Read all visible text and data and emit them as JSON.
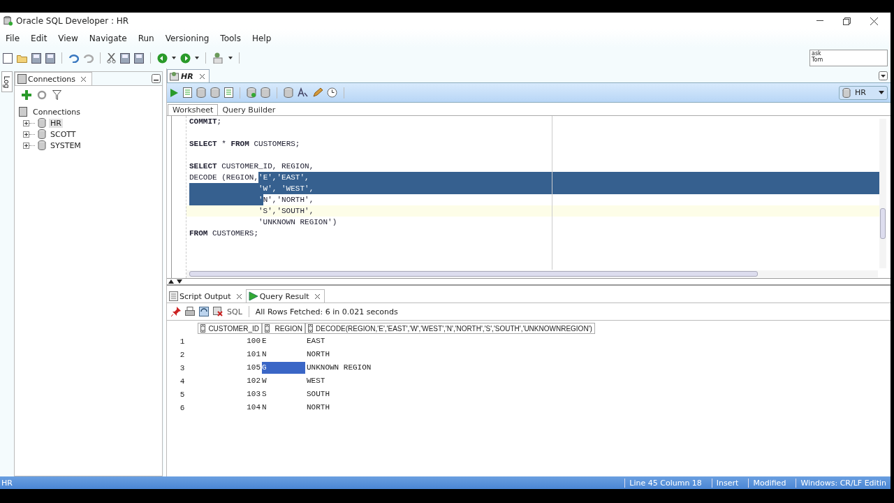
{
  "window": {
    "title": "Oracle SQL Developer : HR"
  },
  "menu": [
    "File",
    "Edit",
    "View",
    "Navigate",
    "Run",
    "Versioning",
    "Tools",
    "Help"
  ],
  "search_box": {
    "lines": [
      "ask",
      "Tom"
    ]
  },
  "left_panel": {
    "side_tab": "Log",
    "tab": "Connections",
    "tree": {
      "label": "Connections",
      "children": [
        {
          "label": "HR",
          "selected": true,
          "expanded": false
        },
        {
          "label": "SCOTT",
          "selected": false,
          "expanded": false
        },
        {
          "label": "SYSTEM",
          "selected": false,
          "expanded": false
        }
      ]
    }
  },
  "editor": {
    "tab": "HR",
    "connection": "HR",
    "subtabs": [
      {
        "label": "Worksheet",
        "selected": true
      },
      {
        "label": "Query Builder",
        "selected": false
      }
    ],
    "lines": [
      {
        "current": false,
        "parts": [
          {
            "text": "**COMMIT**;",
            "selected": false
          }
        ]
      },
      {
        "current": false
      },
      {
        "current": false,
        "parts": [
          {
            "text": "**SELECT** * **FROM** CUSTOMERS;",
            "selected": false
          }
        ]
      },
      {
        "current": false
      },
      {
        "current": false,
        "parts": [
          {
            "text": "**SELECT** CUSTOMER_ID, REGION,",
            "selected": false
          }
        ]
      },
      {
        "current": false,
        "parts": [
          {
            "text": "DECODE (REGION,",
            "selected": false
          },
          {
            "text": "'E','EAST',",
            "selected": true
          }
        ]
      },
      {
        "current": false,
        "parts": [
          {
            "text": "               'W', 'WEST',",
            "selected": true
          }
        ]
      },
      {
        "current": false,
        "parts": [
          {
            "text": "               '",
            "selected": true
          },
          {
            "text": "N','NORTH',",
            "selected": false
          }
        ]
      },
      {
        "current": true,
        "parts": [
          {
            "text": "               'S','SOUTH',",
            "selected": false
          }
        ]
      },
      {
        "current": false,
        "parts": [
          {
            "text": "               'UNKNOWN REGION')",
            "selected": false
          }
        ]
      },
      {
        "current": false,
        "parts": [
          {
            "text": "**FROM** CUSTOMERS;",
            "selected": false
          }
        ]
      }
    ]
  },
  "output": {
    "tabs": [
      {
        "label": "Script Output",
        "selected": false
      },
      {
        "label": "Query Result",
        "selected": true
      }
    ],
    "sql_label": "SQL",
    "message": "All Rows Fetched: 6 in 0.021 seconds",
    "columns": [
      "CUSTOMER_ID",
      "REGION",
      "DECODE(REGION,'E','EAST','W','WEST','N','NORTH','S','SOUTH','UNKNOWNREGION')"
    ],
    "rows": [
      {
        "number": "1",
        "cells": [
          {
            "text": "100",
            "selected": false
          },
          {
            "text": "E",
            "selected": false
          },
          {
            "text": "EAST",
            "selected": false
          }
        ]
      },
      {
        "number": "2",
        "cells": [
          {
            "text": "101",
            "selected": false
          },
          {
            "text": "N",
            "selected": false
          },
          {
            "text": "NORTH",
            "selected": false
          }
        ]
      },
      {
        "number": "3",
        "cells": [
          {
            "text": "105",
            "selected": false
          },
          {
            "text": "G",
            "selected": true
          },
          {
            "text": "UNKNOWN REGION",
            "selected": false
          }
        ]
      },
      {
        "number": "4",
        "cells": [
          {
            "text": "102",
            "selected": false
          },
          {
            "text": "W",
            "selected": false
          },
          {
            "text": "WEST",
            "selected": false
          }
        ]
      },
      {
        "number": "5",
        "cells": [
          {
            "text": "103",
            "selected": false
          },
          {
            "text": "S",
            "selected": false
          },
          {
            "text": "SOUTH",
            "selected": false
          }
        ]
      },
      {
        "number": "6",
        "cells": [
          {
            "text": "104",
            "selected": false
          },
          {
            "text": "N",
            "selected": false
          },
          {
            "text": "NORTH",
            "selected": false
          }
        ]
      }
    ]
  },
  "status_bar": {
    "connection": "HR",
    "items": [
      "Line 45 Column 18",
      "Insert",
      "Modified",
      "Windows: CR/LF Editin"
    ]
  }
}
